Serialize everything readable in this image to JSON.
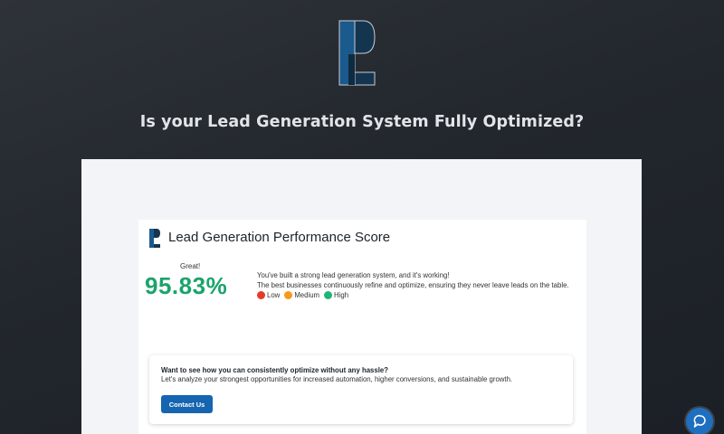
{
  "header": {
    "heading": "Is your Lead Generation System Fully Optimized?",
    "logo_icon": "pl-monogram-logo"
  },
  "card": {
    "title": "Lead Generation Performance Score",
    "rating": "Great!",
    "score": "95.83%",
    "description_line1": "You've built a strong lead generation system, and it's working!",
    "description_line2": "The best businesses continuously refine and optimize, ensuring they never leave leads on the table.",
    "legend": [
      {
        "label": "Low",
        "color": "#e53b2c"
      },
      {
        "label": "Medium",
        "color": "#f39a1e"
      },
      {
        "label": "High",
        "color": "#1fb575"
      }
    ]
  },
  "cta": {
    "heading": "Want to see how you can consistently optimize without any hassle?",
    "text": "Let's analyze your strongest opportunities for increased automation, higher conversions, and sustainable growth.",
    "button_label": "Contact Us"
  },
  "chat": {
    "icon": "chat-bubble-icon"
  },
  "colors": {
    "accent": "#1565b0",
    "score": "#1ca36b"
  }
}
